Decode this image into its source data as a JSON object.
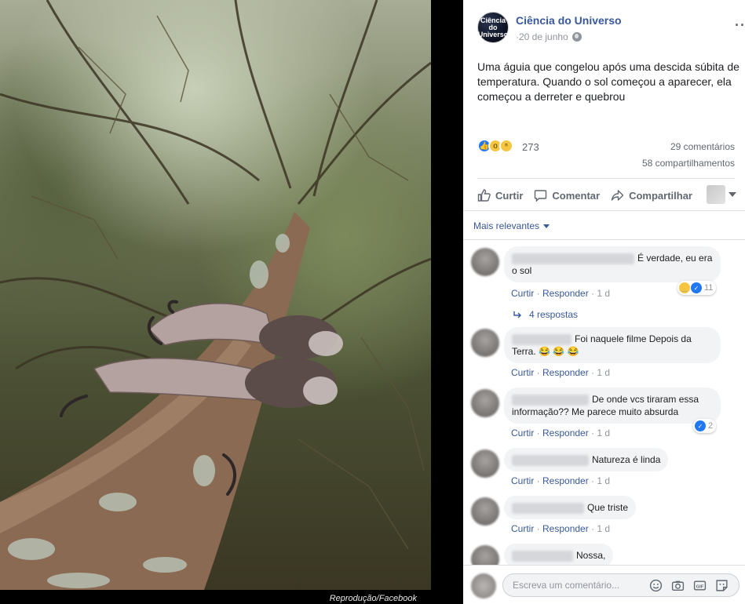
{
  "photo": {
    "caption": "Reprodução/Facebook"
  },
  "post": {
    "page_name": "Ciência do Universo",
    "avatar_text_line1": "Ciência",
    "avatar_text_line2": "do",
    "avatar_text_line3": "Universo",
    "date": "20 de junho",
    "more_options": "···",
    "text": "Uma águia que congelou após uma descida súbita de temperatura. Quando o sol começou a aparecer, ela começou a derreter e quebrou",
    "reaction_count": "273",
    "comments_count": "29 comentários",
    "shares_count": "58 compartilhamentos",
    "reaction_types": [
      "like-icon",
      "wow-icon",
      "sad-icon"
    ]
  },
  "actions": {
    "like": "Curtir",
    "comment": "Comentar",
    "share": "Compartilhar"
  },
  "sort": {
    "label": "Mais relevantes"
  },
  "comments": [
    {
      "text": "É verdade, eu era o sol",
      "like": "Curtir",
      "reply": "Responder",
      "time": "1 d",
      "reaction_count": "11",
      "replies": "4 respostas"
    },
    {
      "text": "Foi naquele filme Depois da Terra. 😂 😂 😂",
      "like": "Curtir",
      "reply": "Responder",
      "time": "1 d"
    },
    {
      "text": "De onde vcs tiraram essa informação?? Me parece muito absurda",
      "like": "Curtir",
      "reply": "Responder",
      "time": "1 d",
      "reaction_count": "2"
    },
    {
      "text": "Natureza é linda",
      "like": "Curtir",
      "reply": "Responder",
      "time": "1 d"
    },
    {
      "text": "Que triste",
      "like": "Curtir",
      "reply": "Responder",
      "time": "1 d"
    },
    {
      "text": "Nossa,"
    }
  ],
  "composer": {
    "placeholder": "Escreva um comentário...",
    "icons": [
      "emoji-icon",
      "camera-icon",
      "gif-icon",
      "sticker-icon"
    ]
  },
  "separator": " · "
}
